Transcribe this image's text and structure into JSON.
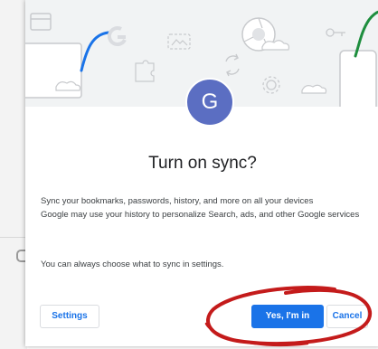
{
  "dialog": {
    "avatar_initial": "G",
    "title": "Turn on sync?",
    "description_1": "Sync your bookmarks, passwords, history, and more on all your devices",
    "description_2": "Google may use your history to personalize Search, ads, and other Google services",
    "description_3": "You can always choose what to sync in settings."
  },
  "buttons": {
    "settings": "Settings",
    "confirm": "Yes, I'm in",
    "cancel": "Cancel"
  },
  "colors": {
    "accent_blue": "#1a73e8",
    "avatar_bg": "#5b6ec2",
    "illustration_bg": "#f1f3f4",
    "annotation_red": "#c41b1b"
  },
  "icons": [
    "browser-window-icon",
    "google-g-icon",
    "puzzle-icon",
    "chrome-icon",
    "sync-icon",
    "gear-icon",
    "key-icon",
    "cloud-icon",
    "phone-icon",
    "laptop-icon"
  ]
}
